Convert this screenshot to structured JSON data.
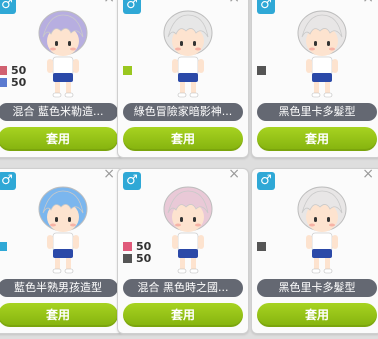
{
  "cards": [
    {
      "gender": "♂",
      "close": "×",
      "hair_color": "#b7aee0",
      "mix": [
        {
          "color": "#d06070",
          "value": "50"
        },
        {
          "color": "#5a7ad0",
          "value": "50"
        }
      ],
      "name": "混合 藍色米勒造...",
      "apply": "套用"
    },
    {
      "gender": "♂",
      "close": "×",
      "hair_color": "#e7e7e7",
      "mix": [
        {
          "color": "#9ac720",
          "value": ""
        }
      ],
      "name": "綠色冒險家暗影神...",
      "apply": "套用"
    },
    {
      "gender": "♂",
      "close": "×",
      "hair_color": "#e8e6e6",
      "mix": [
        {
          "color": "#555555",
          "value": ""
        }
      ],
      "name": "黑色里卡多髮型",
      "apply": "套用"
    },
    {
      "gender": "♂",
      "close": "×",
      "hair_color": "#7bb6ee",
      "mix": [
        {
          "color": "#2fa8d6",
          "value": ""
        }
      ],
      "name": "藍色半熟男孩造型",
      "apply": "套用"
    },
    {
      "gender": "♂",
      "close": "×",
      "hair_color": "#e9c9d7",
      "mix": [
        {
          "color": "#e05a7a",
          "value": "50"
        },
        {
          "color": "#555555",
          "value": "50"
        }
      ],
      "name": "混合 黑色時之國...",
      "apply": "套用"
    },
    {
      "gender": "♂",
      "close": "×",
      "hair_color": "#e8e6e6",
      "mix": [
        {
          "color": "#555555",
          "value": ""
        }
      ],
      "name": "黑色里卡多髮型",
      "apply": "套用"
    }
  ]
}
